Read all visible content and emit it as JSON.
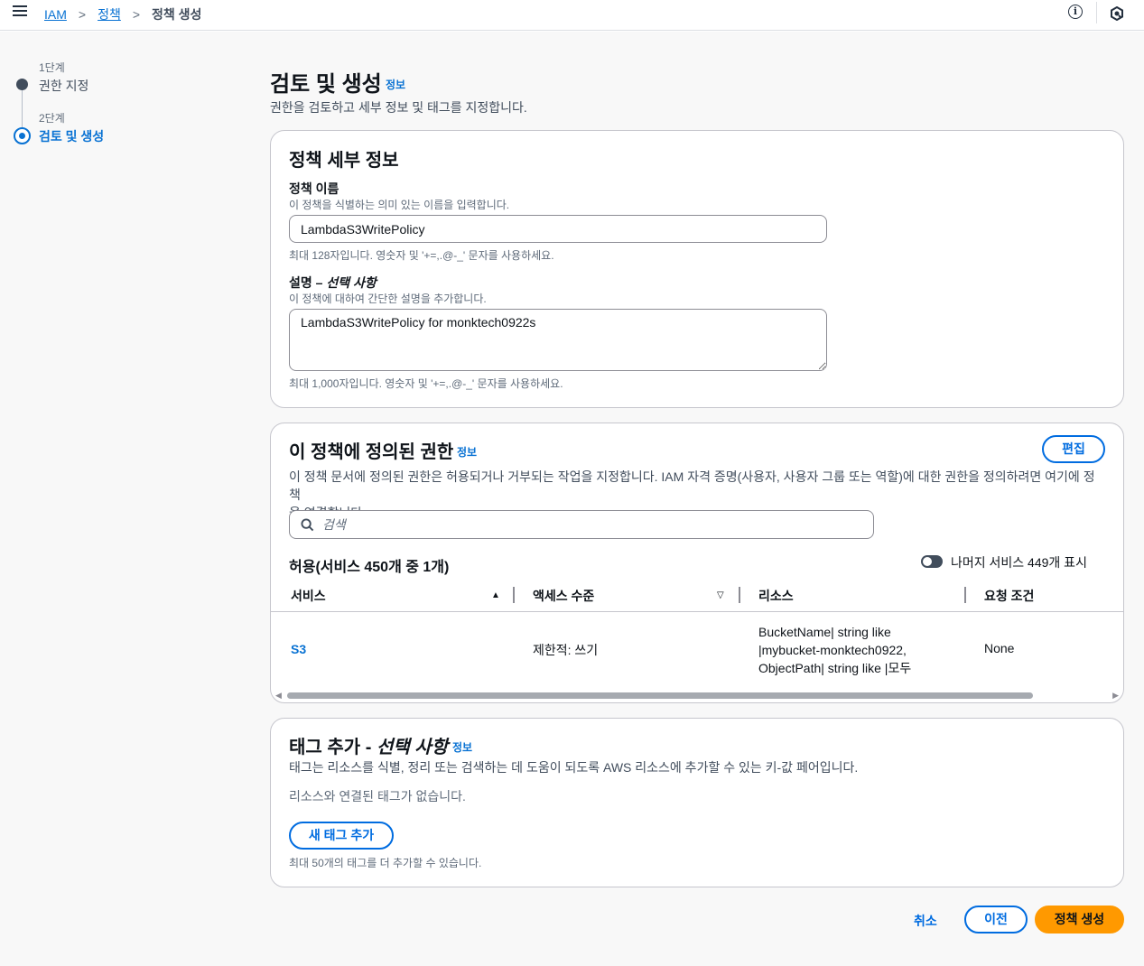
{
  "breadcrumbs": {
    "items": [
      "IAM",
      "정책"
    ],
    "current": "정책 생성",
    "separator": ">"
  },
  "steps": [
    {
      "small": "1단계",
      "label": "권한 지정"
    },
    {
      "small": "2단계",
      "label": "검토 및 생성"
    }
  ],
  "header": {
    "title": "검토 및 생성",
    "info": "정보",
    "description": "권한을 검토하고 세부 정보 및 태그를 지정합니다."
  },
  "details": {
    "title": "정책 세부 정보",
    "name_label": "정책 이름",
    "name_desc": "이 정책을 식별하는 의미 있는 이름을 입력합니다.",
    "name_value": "LambdaS3WritePolicy",
    "name_constraint": "최대 128자입니다. 영숫자 및 '+=,.@-_' 문자를 사용하세요.",
    "desc_label_main": "설명 – ",
    "desc_label_optional": "선택 사항",
    "desc_desc": "이 정책에 대하여 간단한 설명을 추가합니다.",
    "desc_value": "LambdaS3WritePolicy for monktech0922s",
    "desc_constraint": "최대 1,000자입니다. 영숫자 및 '+=,.@-_' 문자를 사용하세요."
  },
  "permissions": {
    "title": "이 정책에 정의된 권한",
    "info": "정보",
    "edit_label": "편집",
    "description_line1": "이 정책 문서에 정의된 권한은 허용되거나 거부되는 작업을 지정합니다. IAM 자격 증명(사용자, 사용자 그룹 또는 역할)에 대한 권한을 정의하려면 여기에 정책",
    "description_line2": "을 연결합니다.",
    "search_placeholder": "검색",
    "allow_heading": "허용(서비스 450개 중 1개)",
    "toggle_label": "나머지 서비스 449개 표시",
    "columns": [
      "서비스",
      "액세스 수준",
      "리소스",
      "요청 조건"
    ],
    "rows": [
      {
        "service": "S3",
        "access": "제한적: 쓰기",
        "resource_lines": [
          "BucketName| string like",
          "|mybucket-monktech0922,",
          "ObjectPath| string like |모두"
        ],
        "condition": "None"
      }
    ]
  },
  "tags": {
    "title_main": "태그 추가 - ",
    "title_optional": "선택 사항",
    "info": "정보",
    "description": "태그는 리소스를 식별, 정리 또는 검색하는 데 도움이 되도록 AWS 리소스에 추가할 수 있는 키-값 페어입니다.",
    "empty_text": "리소스와 연결된 태그가 없습니다.",
    "add_button": "새 태그 추가",
    "limit_text": "최대 50개의 태그를 더 추가할 수 있습니다."
  },
  "footer": {
    "cancel": "취소",
    "previous": "이전",
    "create": "정책 생성"
  },
  "colors": {
    "link": "#0972d3",
    "primary": "#ff9900",
    "border": "#c6c6cd"
  }
}
